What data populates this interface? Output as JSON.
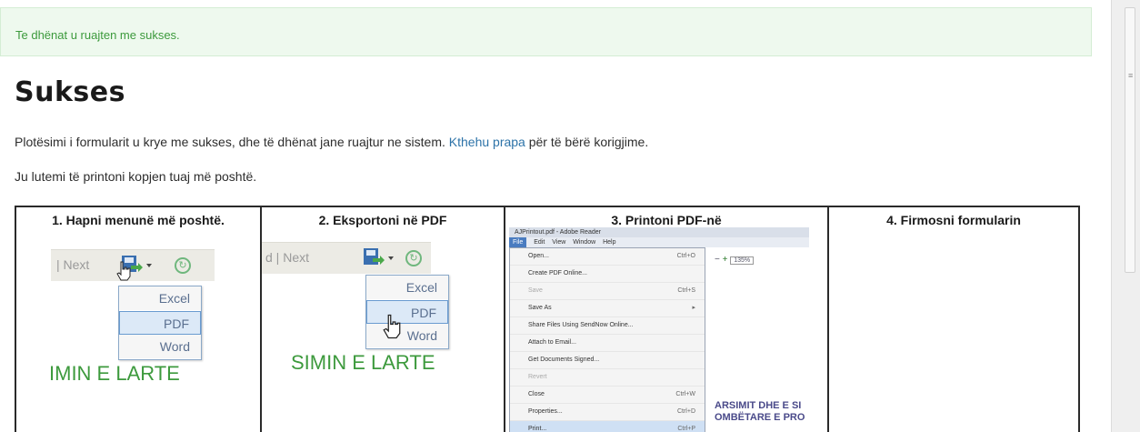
{
  "alert": {
    "message": "Te dhënat u ruajten me sukses."
  },
  "heading": "Sukses",
  "paragraph1": {
    "before": "Plotësimi i formularit u krye me sukses, dhe të dhënat jane ruajtur ne sistem.",
    "link": "Kthehu prapa",
    "after": "për të bërë korigjime."
  },
  "paragraph2": "Ju lutemi të printoni kopjen tuaj më poshtë.",
  "steps": [
    {
      "title": "1. Hapni menunë më poshtë.",
      "toolbar_text": "| Next",
      "menu": [
        "Excel",
        "PDF",
        "Word"
      ],
      "selected": "PDF",
      "caption": "IMIN E LARTE"
    },
    {
      "title": "2. Eksportoni në PDF",
      "toolbar_text": "d | Next",
      "menu": [
        "Excel",
        "PDF",
        "Word"
      ],
      "selected": "PDF",
      "caption": "SIMIN E LARTE"
    },
    {
      "title": "3. Printoni PDF-në",
      "window_title": "AJPrintout.pdf - Adobe Reader",
      "menubar": [
        "File",
        "Edit",
        "View",
        "Window",
        "Help"
      ],
      "file_menu": [
        {
          "label": "Open...",
          "shortcut": "Ctrl+O"
        },
        {
          "label": "Create PDF Online...",
          "shortcut": ""
        },
        {
          "label": "Save",
          "shortcut": "Ctrl+S"
        },
        {
          "label": "Save As",
          "shortcut": ""
        },
        {
          "label": "Share Files Using SendNow Online...",
          "shortcut": ""
        },
        {
          "label": "Attach to Email...",
          "shortcut": ""
        },
        {
          "label": "Get Documents Signed...",
          "shortcut": ""
        },
        {
          "label": "Revert",
          "shortcut": ""
        },
        {
          "label": "Close",
          "shortcut": "Ctrl+W"
        },
        {
          "label": "Properties...",
          "shortcut": "Ctrl+D"
        },
        {
          "label": "Print...",
          "shortcut": "Ctrl+P"
        }
      ],
      "zoom": "135%",
      "doc_text_1": "ARSIMIT DHE E SI",
      "doc_text_2": "OMBËTARE E PRO"
    },
    {
      "title": "4. Firmosni formularin"
    }
  ],
  "colors": {
    "alert_bg": "#eef9ee",
    "alert_text": "#3c9a3c",
    "link": "#2d73a8"
  }
}
